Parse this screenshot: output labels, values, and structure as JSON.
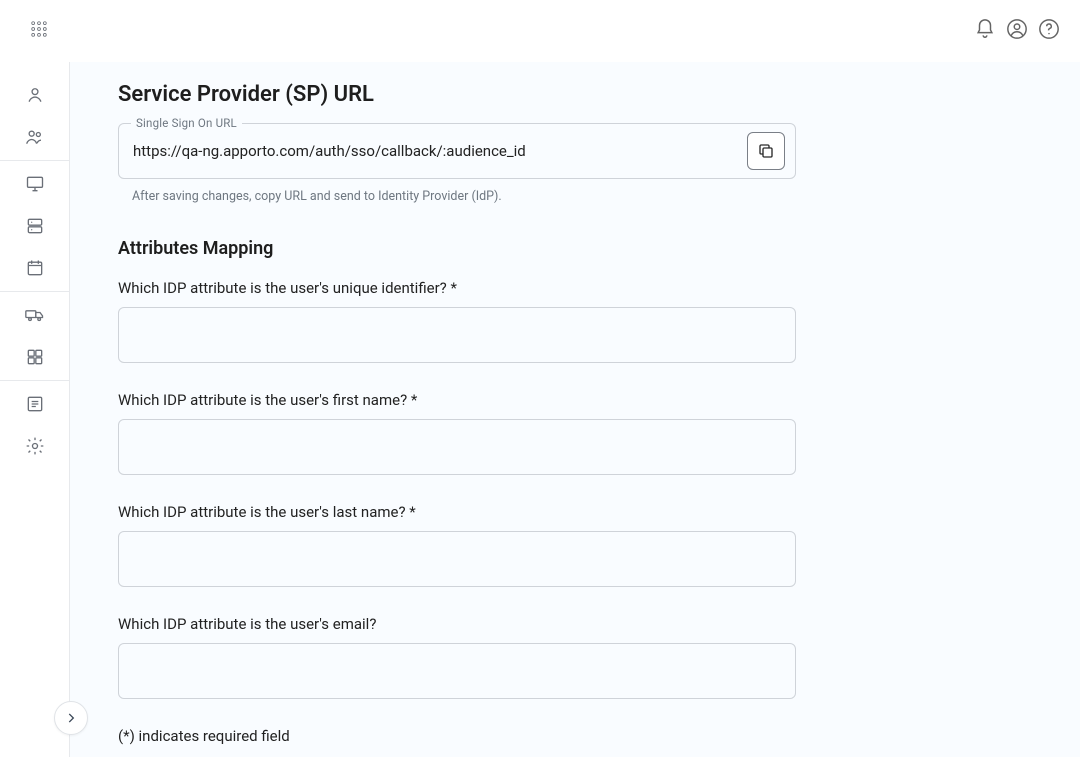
{
  "topbar": {
    "icons": {
      "apps": "apps-icon",
      "bell": "bell-icon",
      "account": "account-icon",
      "help": "help-icon"
    }
  },
  "sidebar": {
    "items": [
      {
        "name": "user-icon"
      },
      {
        "name": "users-group-icon"
      },
      {
        "name": "monitor-icon"
      },
      {
        "name": "server-icon"
      },
      {
        "name": "calendar-icon"
      },
      {
        "name": "truck-icon"
      },
      {
        "name": "grid-icon"
      },
      {
        "name": "list-icon"
      },
      {
        "name": "gear-icon"
      }
    ]
  },
  "sp": {
    "heading": "Service Provider (SP) URL",
    "field_label": "Single Sign On URL",
    "field_value": "https://qa-ng.apporto.com/auth/sso/callback/:audience_id",
    "helper": "After saving changes, copy URL and send to Identity Provider (IdP)."
  },
  "mapping": {
    "heading": "Attributes Mapping",
    "q_uid": "Which IDP attribute is the user's unique identifier? *",
    "q_first": "Which IDP attribute is the user's first name? *",
    "q_last": "Which IDP attribute is the user's last name? *",
    "q_email": "Which IDP attribute is the user's email?",
    "v_uid": "",
    "v_first": "",
    "v_last": "",
    "v_email": "",
    "required_note": "(*) indicates required field"
  }
}
